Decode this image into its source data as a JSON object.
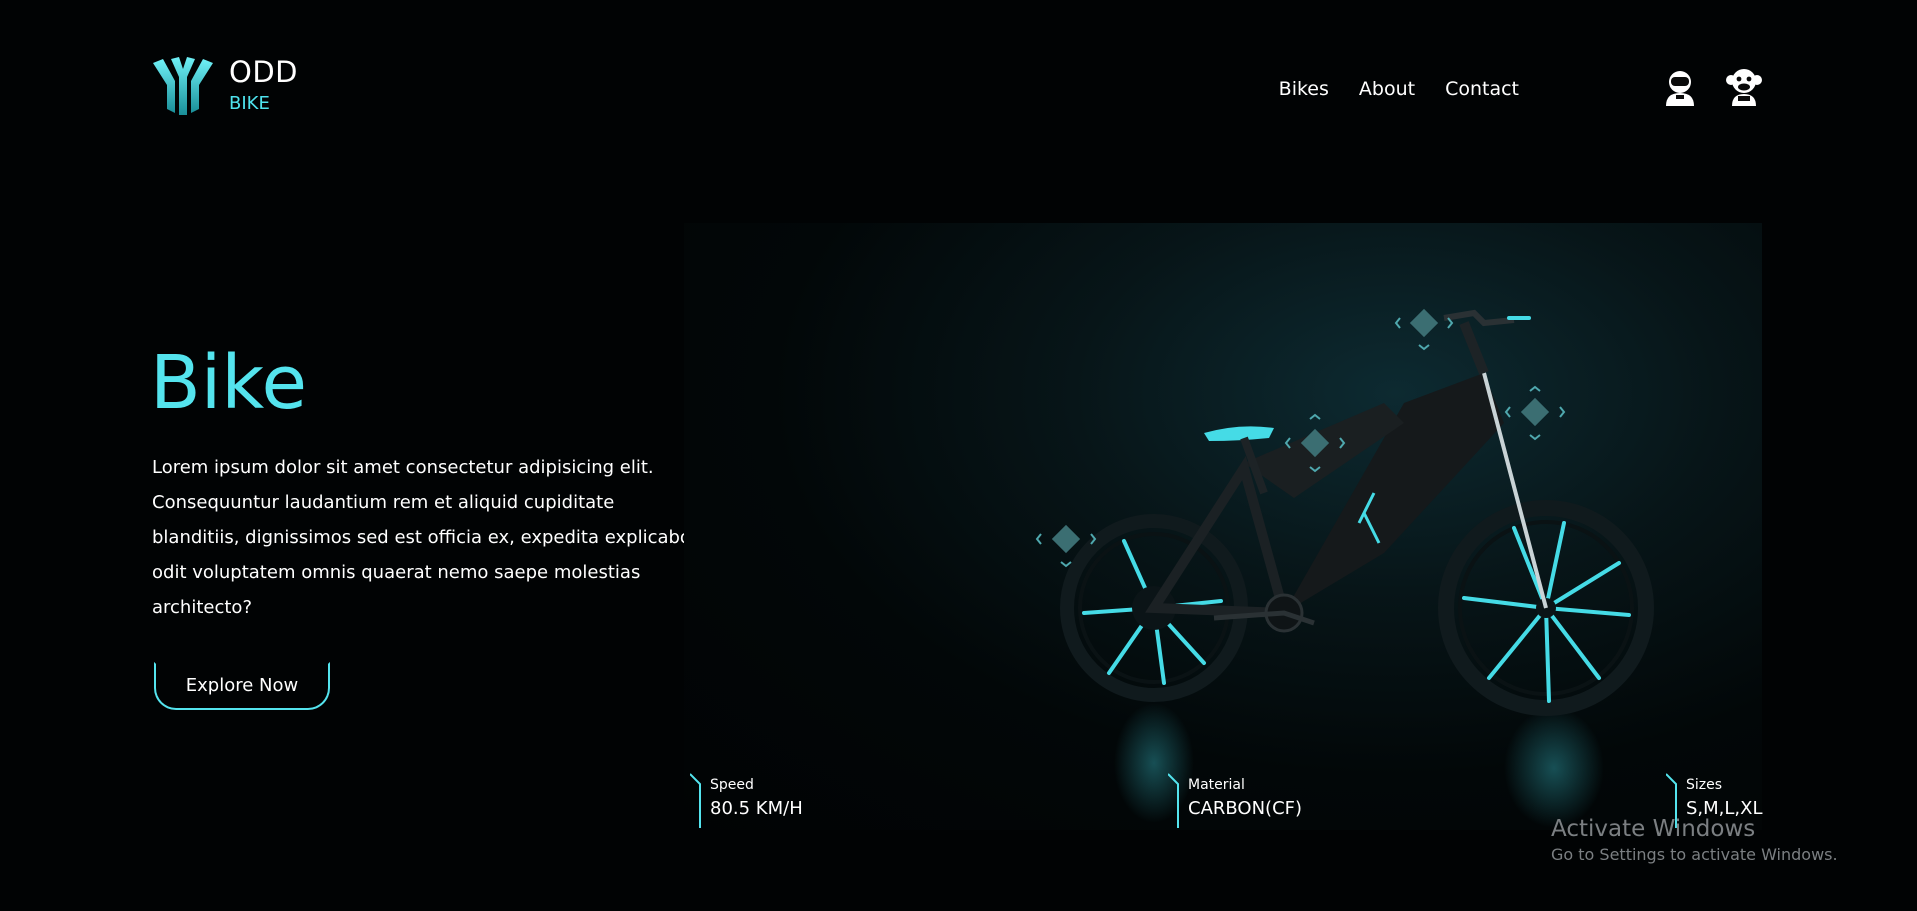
{
  "brand": {
    "title": "ODD",
    "subtitle": "BIKE"
  },
  "nav": {
    "items": [
      "Bikes",
      "About",
      "Contact"
    ]
  },
  "hero": {
    "title": "Bike",
    "description": "Lorem ipsum dolor sit amet consectetur adipisicing elit. Consequuntur laudantium rem et aliquid cupiditate blanditiis, dignissimos sed est officia ex, expedita explicabo odit voluptatem omnis quaerat nemo saepe molestias architecto?",
    "cta_label": "Explore Now"
  },
  "specs": [
    {
      "label": "Speed",
      "value": "80.5 KM/H"
    },
    {
      "label": "Material",
      "value": "CARBON(CF)"
    },
    {
      "label": "Sizes",
      "value": "S,M,L,XL"
    }
  ],
  "watermark": {
    "title": "Activate Windows",
    "subtitle": "Go to Settings to activate Windows."
  },
  "colors": {
    "accent": "#54e4ee",
    "background": "#010304",
    "text": "#ffffff"
  },
  "icons": {
    "avatar_1": "astronaut-avatar-icon",
    "avatar_2": "monkey-avatar-icon"
  }
}
